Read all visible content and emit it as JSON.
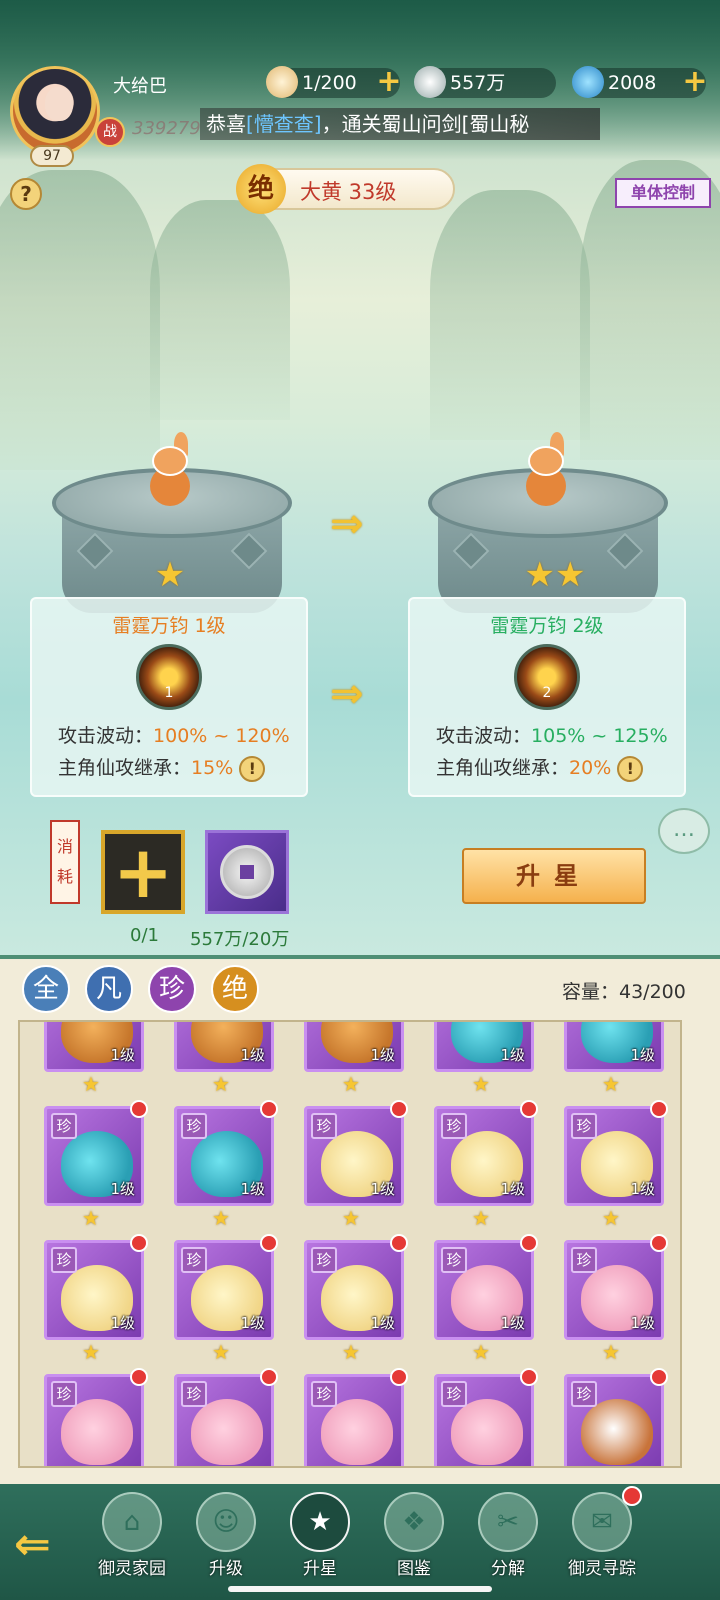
{
  "player": {
    "name": "大给巴",
    "level": "97",
    "power": "339279",
    "battle_label": "战"
  },
  "resources": [
    {
      "icon": "bun-icon",
      "value": "1/200"
    },
    {
      "icon": "silver-coin-icon",
      "value": "557万"
    },
    {
      "icon": "jade-icon",
      "value": "2008"
    }
  ],
  "marquee": {
    "prefix": "恭喜",
    "player": "[懵查查]",
    "suffix": "，通关蜀山问剑[蜀山秘"
  },
  "help_label": "?",
  "pet": {
    "rarity": "绝",
    "title": "大黄 33级"
  },
  "single_control": "单体控制",
  "skills": {
    "current": {
      "name": "雷霆万钧 1级",
      "icon_level": "1",
      "attack_label": "攻击波动：",
      "attack": "100% ~ 120%",
      "inherit_label": "主角仙攻继承：",
      "inherit": "15%"
    },
    "next": {
      "name": "雷霆万钧 2级",
      "icon_level": "2",
      "attack_label": "攻击波动：",
      "attack": "105% ~ 125%",
      "inherit_label": "主角仙攻继承：",
      "inherit": "20%"
    }
  },
  "stars": {
    "current": 1,
    "next": 2
  },
  "consume": {
    "label": "消耗",
    "slot_count": "0/1",
    "coin_count": "557万/20万"
  },
  "upstar_button": "升星",
  "filters": [
    {
      "label": "全",
      "color": "#4a7fb8"
    },
    {
      "label": "凡",
      "color": "#3f6fb0"
    },
    {
      "label": "珍",
      "color": "#8e44ad"
    },
    {
      "label": "绝",
      "color": "#d68f1f"
    }
  ],
  "capacity": "容量：43/200",
  "pets": [
    {
      "type": "tiger",
      "rarity": "",
      "level": "1级",
      "dot": false
    },
    {
      "type": "tiger",
      "rarity": "",
      "level": "1级",
      "dot": false
    },
    {
      "type": "tiger",
      "rarity": "",
      "level": "1级",
      "dot": false
    },
    {
      "type": "dragon",
      "rarity": "",
      "level": "1级",
      "dot": false
    },
    {
      "type": "dragon",
      "rarity": "",
      "level": "1级",
      "dot": false
    },
    {
      "type": "dragon",
      "rarity": "珍",
      "level": "1级",
      "dot": true
    },
    {
      "type": "dragon",
      "rarity": "珍",
      "level": "1级",
      "dot": true
    },
    {
      "type": "pear",
      "rarity": "珍",
      "level": "1级",
      "dot": true
    },
    {
      "type": "pear",
      "rarity": "珍",
      "level": "1级",
      "dot": true
    },
    {
      "type": "pear",
      "rarity": "珍",
      "level": "1级",
      "dot": true
    },
    {
      "type": "pear",
      "rarity": "珍",
      "level": "1级",
      "dot": true
    },
    {
      "type": "pear",
      "rarity": "珍",
      "level": "1级",
      "dot": true
    },
    {
      "type": "pear",
      "rarity": "珍",
      "level": "1级",
      "dot": true
    },
    {
      "type": "pink",
      "rarity": "珍",
      "level": "1级",
      "dot": true
    },
    {
      "type": "pink",
      "rarity": "珍",
      "level": "1级",
      "dot": true
    },
    {
      "type": "pink",
      "rarity": "珍",
      "level": "",
      "dot": true
    },
    {
      "type": "pink",
      "rarity": "珍",
      "level": "",
      "dot": true
    },
    {
      "type": "pink",
      "rarity": "珍",
      "level": "",
      "dot": true
    },
    {
      "type": "pink",
      "rarity": "珍",
      "level": "",
      "dot": true
    },
    {
      "type": "dog",
      "rarity": "珍",
      "level": "",
      "dot": true
    }
  ],
  "nav": [
    {
      "label": "御灵家园",
      "icon": "home-icon",
      "glyph": "⌂",
      "active": false,
      "dot": false
    },
    {
      "label": "升级",
      "icon": "levelup-icon",
      "glyph": "☺",
      "active": false,
      "dot": false
    },
    {
      "label": "升星",
      "icon": "upstar-icon",
      "glyph": "★",
      "active": true,
      "dot": false
    },
    {
      "label": "图鉴",
      "icon": "codex-icon",
      "glyph": "❖",
      "active": false,
      "dot": false
    },
    {
      "label": "分解",
      "icon": "decompose-icon",
      "glyph": "✂",
      "active": false,
      "dot": false
    },
    {
      "label": "御灵寻踪",
      "icon": "search-icon",
      "glyph": "✉",
      "active": false,
      "dot": true
    }
  ]
}
